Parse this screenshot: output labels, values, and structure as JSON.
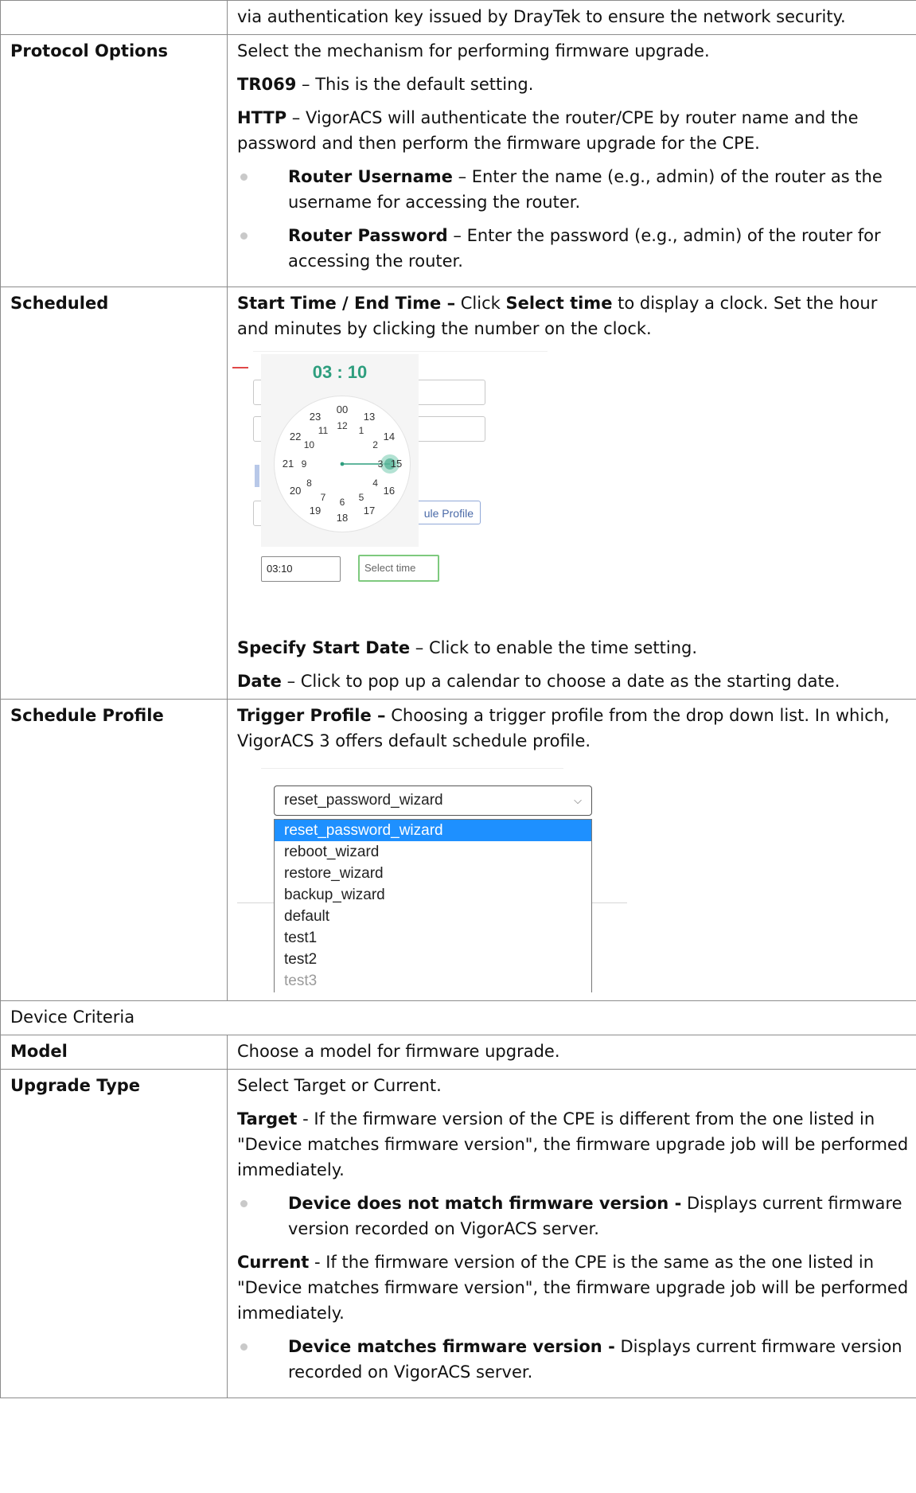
{
  "rows": {
    "intro": {
      "text": "via authentication key issued by DrayTek to ensure the network security."
    },
    "protocol": {
      "label": "Protocol Options",
      "p1": "Select the mechanism for performing firmware upgrade.",
      "tr069_term": "TR069",
      "tr069_desc": " – This is the default setting.",
      "http_term": "HTTP",
      "http_desc": " – VigorACS will authenticate the router/CPE by router name and the password and then perform the firmware upgrade for the CPE.",
      "bullets": [
        {
          "term": "Router Username",
          "desc": " – Enter the name (e.g., admin) of the router as the username for accessing the router."
        },
        {
          "term": "Router Password",
          "desc": " – Enter the password (e.g., admin) of the router for accessing the router."
        }
      ]
    },
    "scheduled": {
      "label": "Scheduled",
      "term1": "Start Time / End Time –",
      "t1a": " Click ",
      "term_select": "Select time",
      "t1b": " to display a clock. Set the hour and minutes by clicking the number on the clock.",
      "clock": {
        "time_hours": "03",
        "time_sep": " : ",
        "time_minutes": "10",
        "numbers": [
          "00",
          "13",
          "14",
          "15",
          "16",
          "17",
          "18",
          "19",
          "20",
          "21",
          "22",
          "23",
          "12",
          "1",
          "2",
          "3",
          "4",
          "5",
          "6",
          "7",
          "8",
          "9",
          "10",
          "11"
        ],
        "input_value": "03:10",
        "select_button": "Select time",
        "profile_button_partial": "ule Profile",
        "partial_char": "e",
        "accent_color": "#2e9e7e"
      },
      "term2": "Specify Start Date",
      "t2": " – Click to enable the time setting.",
      "term3": "Date",
      "t3": " – Click to pop up a calendar to choose a date as the starting date."
    },
    "schedule_profile": {
      "label": "Schedule Profile",
      "term": "Trigger Profile –",
      "desc": " Choosing a trigger profile from the drop down list. In which, VigorACS 3 offers default schedule profile.",
      "dropdown": {
        "selected": "reset_password_wizard",
        "chevron_icon": "chevron-down-icon",
        "chevron_glyph": "⌵",
        "options": [
          "reset_password_wizard",
          "reboot_wizard",
          "restore_wizard",
          "backup_wizard",
          "default",
          "test1",
          "test2",
          "test3"
        ],
        "highlight_color": "#1e90ff"
      }
    },
    "device_criteria": {
      "label": "Device Criteria"
    },
    "model": {
      "label": "Model",
      "desc": "Choose a model for firmware upgrade."
    },
    "upgrade_type": {
      "label": "Upgrade Type",
      "p1": "Select Target or Current.",
      "target_term": "Target",
      "target_desc": " - If the firmware version of the CPE is different from the one listed in \"Device matches firmware version\", the firmware upgrade job will be performed immediately.",
      "target_bullet_term": "Device does not match firmware version -",
      "target_bullet_desc": " Displays current firmware version recorded on VigorACS server.",
      "current_term": "Current",
      "current_desc": " - If the firmware version of the CPE is the same as the one listed in \"Device matches firmware version\", the firmware upgrade job will be performed immediately.",
      "current_bullet_term": "Device matches firmware version -",
      "current_bullet_desc": " Displays current firmware version recorded on VigorACS server."
    }
  }
}
